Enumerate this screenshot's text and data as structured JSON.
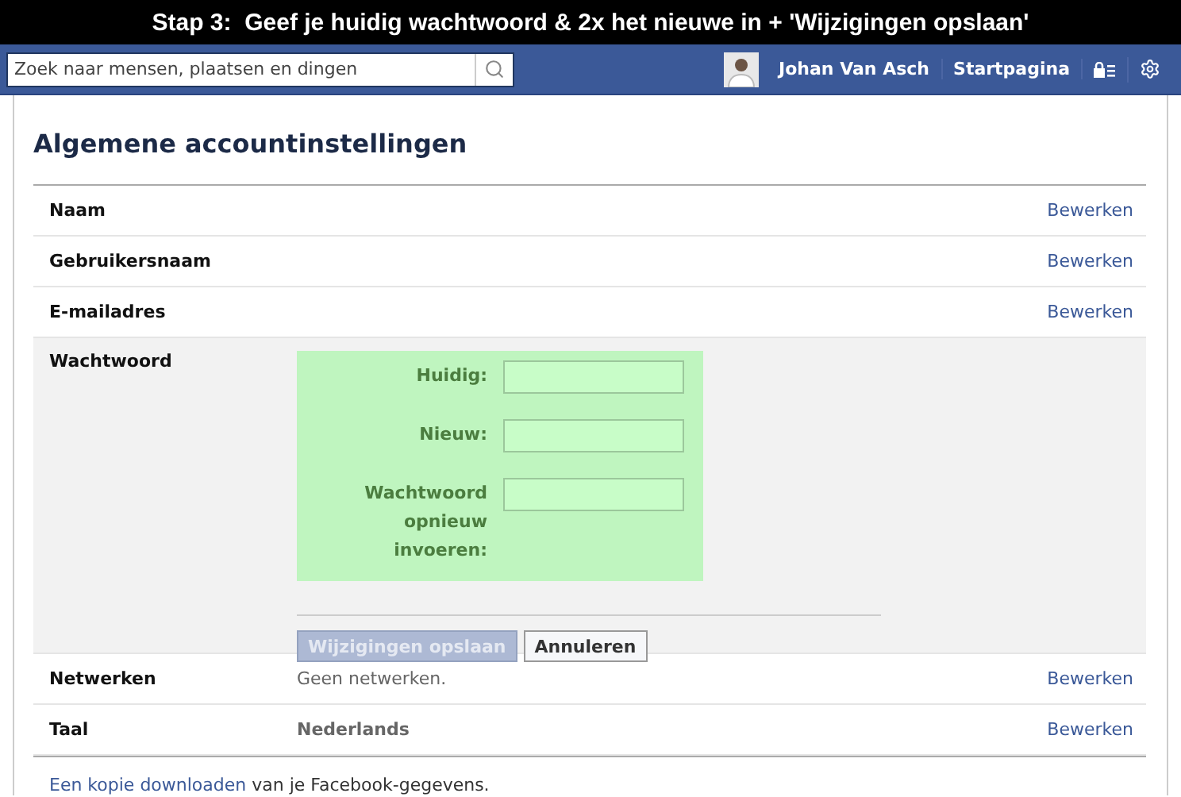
{
  "caption": "Stap 3:  Geef je huidig wachtwoord & 2x het nieuwe in + 'Wijzigingen opslaan'",
  "topbar": {
    "search": {
      "placeholder": "Zoek naar mensen, plaatsen en dingen"
    },
    "user": "Johan Van Asch",
    "home": "Startpagina"
  },
  "settings": {
    "title": "Algemene accountinstellingen",
    "rows": [
      {
        "label": "Naam",
        "action": "Bewerken",
        "expanded": false
      },
      {
        "label": "Gebruikersnaam",
        "action": "Bewerken",
        "expanded": false
      },
      {
        "label": "E-mailadres",
        "action": "Bewerken",
        "expanded": false
      },
      {
        "label": "Wachtwoord",
        "expanded": true,
        "form": {
          "fields": [
            {
              "label": "Huidig:"
            },
            {
              "label": "Nieuw:"
            },
            {
              "label": "Wachtwoord opnieuw invoeren:"
            }
          ],
          "buttons": [
            {
              "label": "Wijzigingen opslaan",
              "disabled": true
            },
            {
              "label": "Annuleren",
              "disabled": false
            }
          ]
        }
      },
      {
        "label": "Netwerken",
        "value": "Geen netwerken.",
        "value_bold": false,
        "action": "Bewerken",
        "expanded": false
      },
      {
        "label": "Taal",
        "value": "Nederlands",
        "value_bold": true,
        "action": "Bewerken",
        "expanded": false
      }
    ]
  },
  "footer": {
    "link": "Een kopie downloaden",
    "text": " van je Facebook-gegevens."
  }
}
